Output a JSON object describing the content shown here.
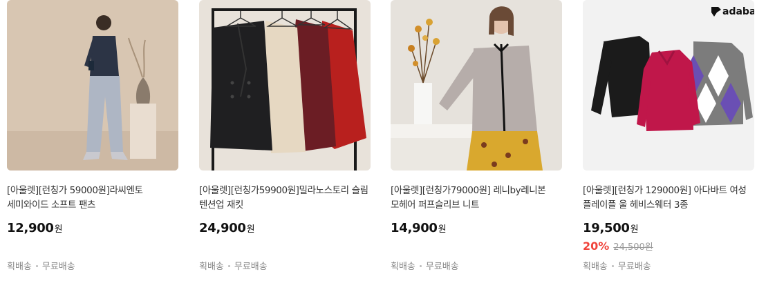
{
  "products": [
    {
      "title": "[아울렛][런칭가 59000원]라씨엔토 세미와이드 소프트 팬츠",
      "price": "12,900",
      "currency": "원",
      "discount": "",
      "original_price": "",
      "shipping": [
        "획배송",
        "무료배송"
      ]
    },
    {
      "title": "[아울렛][런칭가59900원]밀라노스토리 슬림 텐션업 재킷",
      "price": "24,900",
      "currency": "원",
      "discount": "",
      "original_price": "",
      "shipping": [
        "획배송",
        "무료배송"
      ]
    },
    {
      "title": "[아울렛][런칭가79000원] 레니by레니본 모헤어 퍼프슬리브 니트",
      "price": "14,900",
      "currency": "원",
      "discount": "",
      "original_price": "",
      "shipping": [
        "획배송",
        "무료배송"
      ]
    },
    {
      "title": "[아울렛][런칭가 129000원] 아다바트 여성 플레이플 울 헤비스웨터 3종",
      "price": "19,500",
      "currency": "원",
      "discount": "20%",
      "original_price": "24,500원",
      "shipping": [
        "획배송",
        "무료배송"
      ],
      "brand_logo": "adabat"
    }
  ],
  "colors": {
    "discount": "#f0443c",
    "muted": "#888888",
    "image_bg_1": "#d8c6b2",
    "image_bg_2": "#e8e2da",
    "image_bg_3": "#e6e2dc",
    "image_bg_4": "#f2f2f2"
  }
}
